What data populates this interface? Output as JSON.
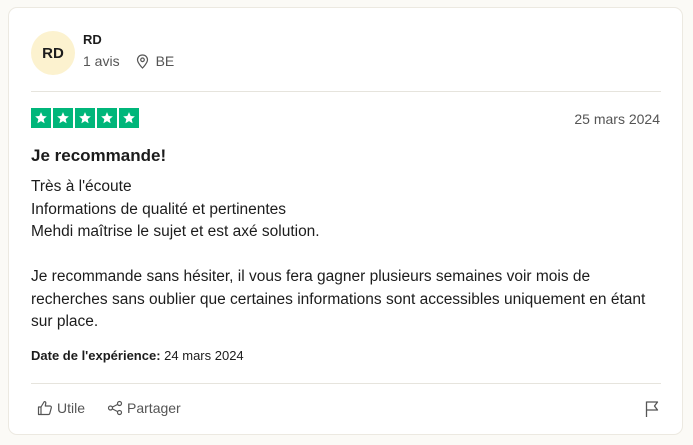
{
  "reviewer": {
    "initials": "RD",
    "name": "RD",
    "review_count": "1 avis",
    "country": "BE"
  },
  "review": {
    "rating": 5,
    "date": "25 mars 2024",
    "title": "Je recommande!",
    "lines": [
      "Très à l'écoute",
      "Informations de qualité et pertinentes",
      "Mehdi maîtrise le sujet et est axé solution."
    ],
    "paragraph": "Je recommande sans hésiter, il vous fera gagner plusieurs semaines voir mois de recherches sans oublier que certaines informations sont accessibles uniquement en étant sur place.",
    "experience_label": "Date de l'expérience:",
    "experience_date": "24 mars 2024"
  },
  "actions": {
    "useful_label": "Utile",
    "share_label": "Partager"
  },
  "colors": {
    "star_green": "#00b67a",
    "avatar_bg": "#fcf2cf"
  },
  "icons": [
    "location-pin-icon",
    "star-icon",
    "thumbs-up-icon",
    "share-icon",
    "flag-icon"
  ]
}
